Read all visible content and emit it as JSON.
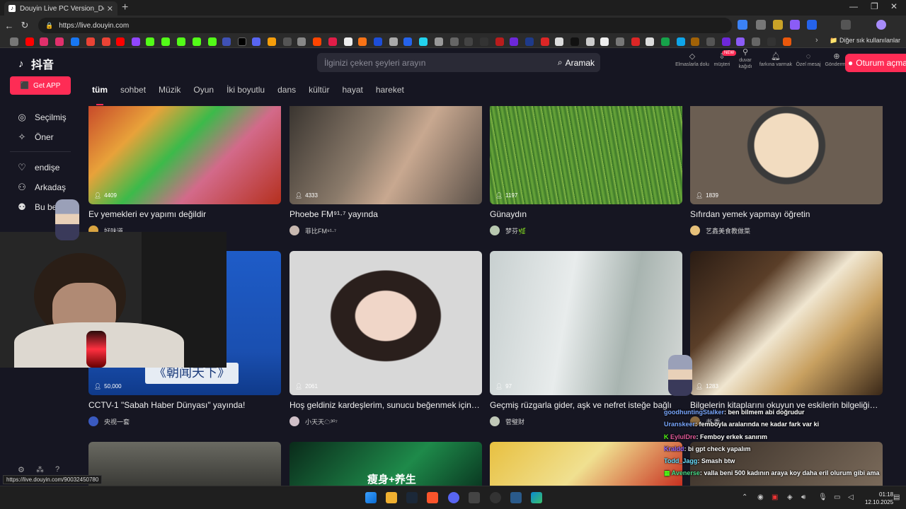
{
  "browser": {
    "tab_title": "Douyin Live PC Version_Douyin L",
    "tab_icon": "tiktok-icon",
    "url": "https://live.douyin.com",
    "bookmarks_folder": "Diğer sık kullanılanlar"
  },
  "site": {
    "logo_text": "抖音",
    "search_placeholder": "İlginizi çeken şeyleri arayın",
    "search_button": "Aramak",
    "new_badge": "NEW",
    "header_actions": [
      {
        "icon": "diamond-icon",
        "label": "Elmaslarla dolu"
      },
      {
        "icon": "customer-icon",
        "label": "müşteri"
      },
      {
        "icon": "wall-icon",
        "label": "duvar kağıdı"
      },
      {
        "icon": "bell-icon",
        "label": "farkına varmak"
      },
      {
        "icon": "message-icon",
        "label": "Özel mesaj"
      },
      {
        "icon": "send-icon",
        "label": "Gönderme"
      }
    ],
    "login_button": "Oturum açma",
    "get_app": "Get APP",
    "sidebar": [
      {
        "icon": "featured-icon",
        "label": "Seçilmiş"
      },
      {
        "icon": "recommend-icon",
        "label": "Öner"
      },
      {
        "icon": "follow-icon",
        "label": "endişe"
      },
      {
        "icon": "friends-icon",
        "label": "Arkadaş"
      },
      {
        "icon": "me-icon",
        "label": "Bu be"
      }
    ],
    "categories": [
      "tüm",
      "sohbet",
      "Müzik",
      "Oyun",
      "İki boyutlu",
      "dans",
      "kültür",
      "hayat",
      "hareket"
    ],
    "active_category": "tüm"
  },
  "streams": [
    {
      "viewers": "4409",
      "title": "Ev yemekleri ev yapımı değildir",
      "author": "好味道"
    },
    {
      "viewers": "4333",
      "title": "Phoebe FM⁹¹·⁷ yayında",
      "author": "菲比FM⁹¹·⁷"
    },
    {
      "viewers": "1197",
      "title": "Günaydın",
      "author": "梦芬🌿"
    },
    {
      "viewers": "1839",
      "title": "Sıfırdan yemek yapmayı öğretin",
      "author": "艺鑫美食教做菜"
    },
    {
      "viewers": "50,000",
      "title": "CCTV-1 \"Sabah Haber Dünyası\" yayında!",
      "author": "央视一套"
    },
    {
      "viewers": "2061",
      "title": "Hoş geldiniz kardeşlerim, sunucu beğenmek için ço...",
      "author": "小天天☁³⁰⁷"
    },
    {
      "viewers": "97",
      "title": "Geçmiş rüzgarla gider, aşk ve nefret isteğe bağlı",
      "author": "菅璧财"
    },
    {
      "viewers": "1283",
      "title": "Bilgelerin kitaplarını okuyun ve eskilerin bilgeliğini t...",
      "author": "书 香"
    }
  ],
  "row3_overlay_text": "瘦身+养生",
  "row1_thumb_text": "《朝闻天下》",
  "chat": [
    {
      "user": "goodhuntingStalker",
      "msg": ": ben bilmem abi doğrudur"
    },
    {
      "user": "Uranskeer",
      "msg": ": femboyla aralarında ne kadar fark var ki"
    },
    {
      "user": "EylulDre",
      "msg": ": Femboy erkek sanırım"
    },
    {
      "user": "Kraldd",
      "msg": ": bi gpt check yapalım"
    },
    {
      "user": "Todd_Jagg",
      "msg": ": Smash btw"
    },
    {
      "user": "Avenerse",
      "msg": ": valla beni 500 kadının araya koy daha eril olurum gibi ama"
    }
  ],
  "status_url": "https://live.douyin.com/90032450780",
  "clock": {
    "time": "01:18",
    "date": "12.10.2025"
  },
  "colors": {
    "accent": "#fe2c55",
    "page_bg": "#161622"
  }
}
